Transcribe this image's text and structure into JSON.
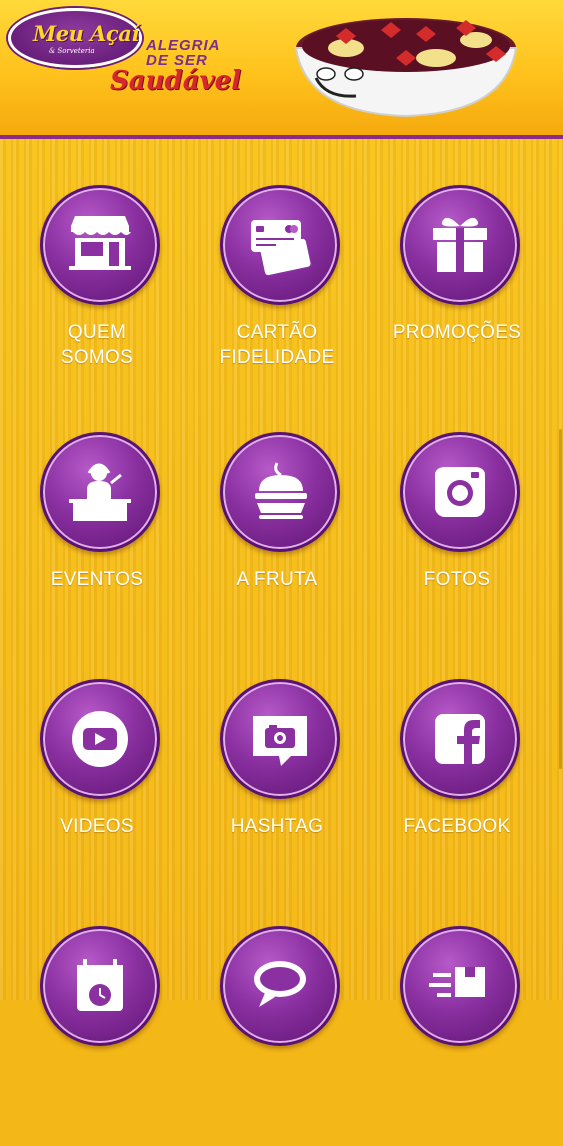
{
  "header": {
    "logo_text": "Meu Açaí",
    "logo_subtext": "& Sorveteria",
    "slogan_line1": "ALEGRIA",
    "slogan_line2": "DE SER",
    "slogan_line3": "Saudável"
  },
  "menu": [
    {
      "label_line1": "QUEM",
      "label_line2": "SOMOS",
      "icon": "store-icon"
    },
    {
      "label_line1": "CARTÃO",
      "label_line2": "FIDELIDADE",
      "icon": "credit-card-icon"
    },
    {
      "label_line1": "PROMOÇÕES",
      "label_line2": "",
      "icon": "gift-icon"
    },
    {
      "label_line1": "EVENTOS",
      "label_line2": "",
      "icon": "dj-icon"
    },
    {
      "label_line1": "A FRUTA",
      "label_line2": "",
      "icon": "fruit-bowl-icon"
    },
    {
      "label_line1": "FOTOS",
      "label_line2": "",
      "icon": "instagram-icon"
    },
    {
      "label_line1": "VIDEOS",
      "label_line2": "",
      "icon": "youtube-icon"
    },
    {
      "label_line1": "HASHTAG",
      "label_line2": "",
      "icon": "camera-bubble-icon"
    },
    {
      "label_line1": "FACEBOOK",
      "label_line2": "",
      "icon": "facebook-icon"
    },
    {
      "label_line1": "",
      "label_line2": "",
      "icon": "calendar-icon"
    },
    {
      "label_line1": "",
      "label_line2": "",
      "icon": "chat-bubble-icon"
    },
    {
      "label_line1": "",
      "label_line2": "",
      "icon": "delivery-box-icon"
    }
  ],
  "colors": {
    "purple": "#8a30a0",
    "yellow": "#f3b718",
    "red": "#d8262f"
  }
}
